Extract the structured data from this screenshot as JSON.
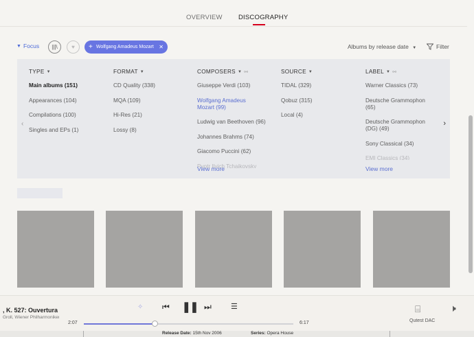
{
  "tabs": [
    {
      "label": "OVERVIEW"
    },
    {
      "label": "DISCOGRAPHY"
    }
  ],
  "focus": {
    "label": "Focus",
    "chip_label": "Wolfgang Amadeus Mozart",
    "sort_label": "Albums by release date",
    "filter_label": "Filter"
  },
  "filters": {
    "type": {
      "header": "TYPE",
      "items": [
        "Main albums (151)",
        "Appearances (104)",
        "Compilations (100)",
        "Singles and EPs (1)"
      ]
    },
    "format": {
      "header": "FORMAT",
      "items": [
        "CD Quality (338)",
        "MQA (109)",
        "Hi-Res (21)",
        "Lossy (8)"
      ]
    },
    "composers": {
      "header": "COMPOSERS",
      "items": [
        "Giuseppe Verdi (103)",
        "Wolfgang Amadeus Mozart (99)",
        "Ludwig van Beethoven (96)",
        "Johannes Brahms (74)",
        "Giacomo Puccini (62)",
        "Pyotr Ilyich Tchaikovsky"
      ],
      "view_more": "View more"
    },
    "source": {
      "header": "SOURCE",
      "items": [
        "TIDAL (329)",
        "Qobuz (315)",
        "Local (4)"
      ]
    },
    "label": {
      "header": "LABEL",
      "items": [
        "Warner Classics (73)",
        "Deutsche Grammophon (65)",
        "Deutsche Grammophon (DG) (49)",
        "Sony Classical (34)",
        "EMI Classics (34)"
      ],
      "view_more": "View more"
    }
  },
  "player": {
    "title": ", K. 527: Ouvertura",
    "artist": "Groll, Wiener Philharmoniker",
    "elapsed": "2:07",
    "duration": "6:17",
    "progress": 0.34,
    "device": "Qutest DAC"
  },
  "behind": {
    "release_label": "Release Date:",
    "release_value": "15th Nov 2006",
    "series_label": "Series:",
    "series_value": "Opera House"
  },
  "colors": {
    "accent": "#6875e2",
    "tab_underline": "#d5001c",
    "tile": "#a5a4a2"
  }
}
